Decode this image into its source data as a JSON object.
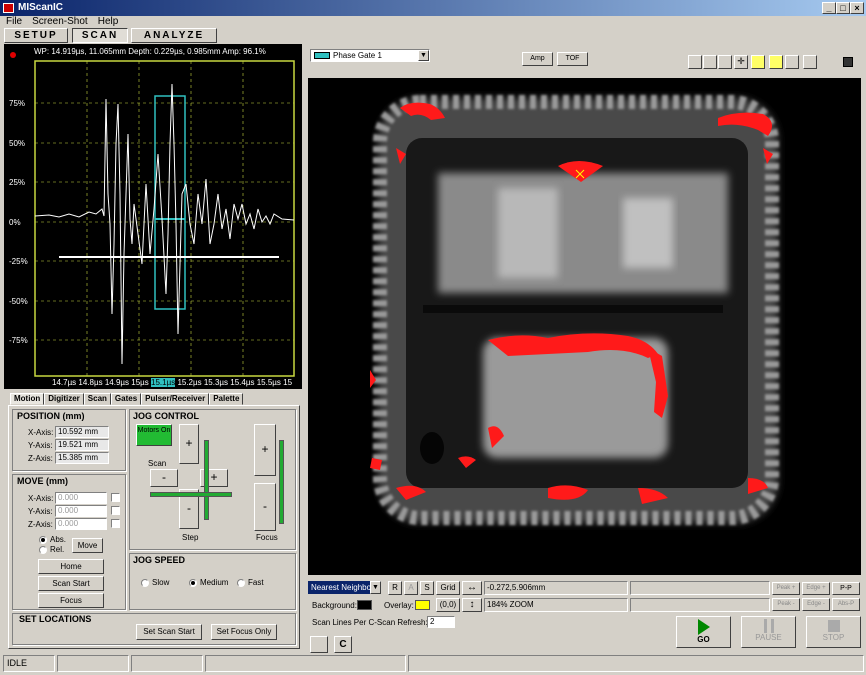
{
  "window": {
    "title": "MIScanIC"
  },
  "menu": [
    "File",
    "Screen-Shot",
    "Help"
  ],
  "modes": {
    "setup": "SETUP",
    "scan": "SCAN",
    "analyze": "ANALYZE"
  },
  "waveform": {
    "readout": "WP: 14.919µs, 11.065mm Depth: 0.229µs, 0.985mm Amp: 96.1%",
    "y_ticks": [
      "75%",
      "50%",
      "25%",
      "0%",
      "-25%",
      "-50%",
      "-75%"
    ],
    "x_ticks": [
      "14.7µs",
      "14.8µs",
      "14.9µs",
      "15µs",
      "15.1µs",
      "15.2µs",
      "15.3µs",
      "15.4µs",
      "15.5µs",
      "15"
    ]
  },
  "tabs": [
    "Motion",
    "Digitizer",
    "Scan",
    "Gates",
    "Pulser/Receiver",
    "Palette"
  ],
  "position": {
    "title": "POSITION (mm)",
    "x_label": "X-Axis:",
    "x": "10.592 mm",
    "y_label": "Y-Axis:",
    "y": "19.521 mm",
    "z_label": "Z-Axis:",
    "z": "15.385 mm"
  },
  "move": {
    "title": "MOVE (mm)",
    "x_label": "X-Axis:",
    "y_label": "Y-Axis:",
    "z_label": "Z-Axis:",
    "x": "0.000",
    "y": "0.000",
    "z": "0.000",
    "abs": "Abs.",
    "rel": "Rel.",
    "move_btn": "Move",
    "home": "Home",
    "scan_start": "Scan Start",
    "focus": "Focus"
  },
  "jog": {
    "title": "JOG CONTROL",
    "motors": "Motors On",
    "scan": "Scan",
    "step": "Step",
    "focus": "Focus",
    "plus": "+",
    "minus": "-"
  },
  "jog_speed": {
    "title": "JOG SPEED",
    "slow": "Slow",
    "medium": "Medium",
    "fast": "Fast"
  },
  "set_locations": {
    "title": "SET LOCATIONS",
    "scan_start": "Set Scan Start",
    "focus_only": "Set Focus Only"
  },
  "gate": {
    "selected": "Phase Gate 1",
    "amp": "Amp",
    "tof": "TOF"
  },
  "bottom": {
    "interp": "Nearest Neighbor",
    "r": "R",
    "a": "A",
    "s": "S",
    "grid": "Grid",
    "coord": "-0.272,5.906mm",
    "zoom": "184% ZOOM",
    "background": "Background:",
    "overlay": "Overlay:",
    "origin": "(0,0)",
    "lines_label": "Scan Lines Per C-Scan Refresh:",
    "lines": "2",
    "peak": "Peak +",
    "edge": "Edge +",
    "pp": "P-P",
    "peak2": "Peak -",
    "edge2": "Edge -",
    "absp": "Abs-P"
  },
  "controls": {
    "go": "GO",
    "pause": "PAUSE",
    "stop": "STOP"
  },
  "status": {
    "state": "IDLE"
  },
  "colors": {
    "title_start": "#0a246a",
    "title_end": "#a6caf0",
    "grid": "#c8d840",
    "wave": "#ffffff",
    "gate": "#30c0c0",
    "motors": "#22bb33",
    "overlay": "#ffff00",
    "go": "#008800"
  }
}
